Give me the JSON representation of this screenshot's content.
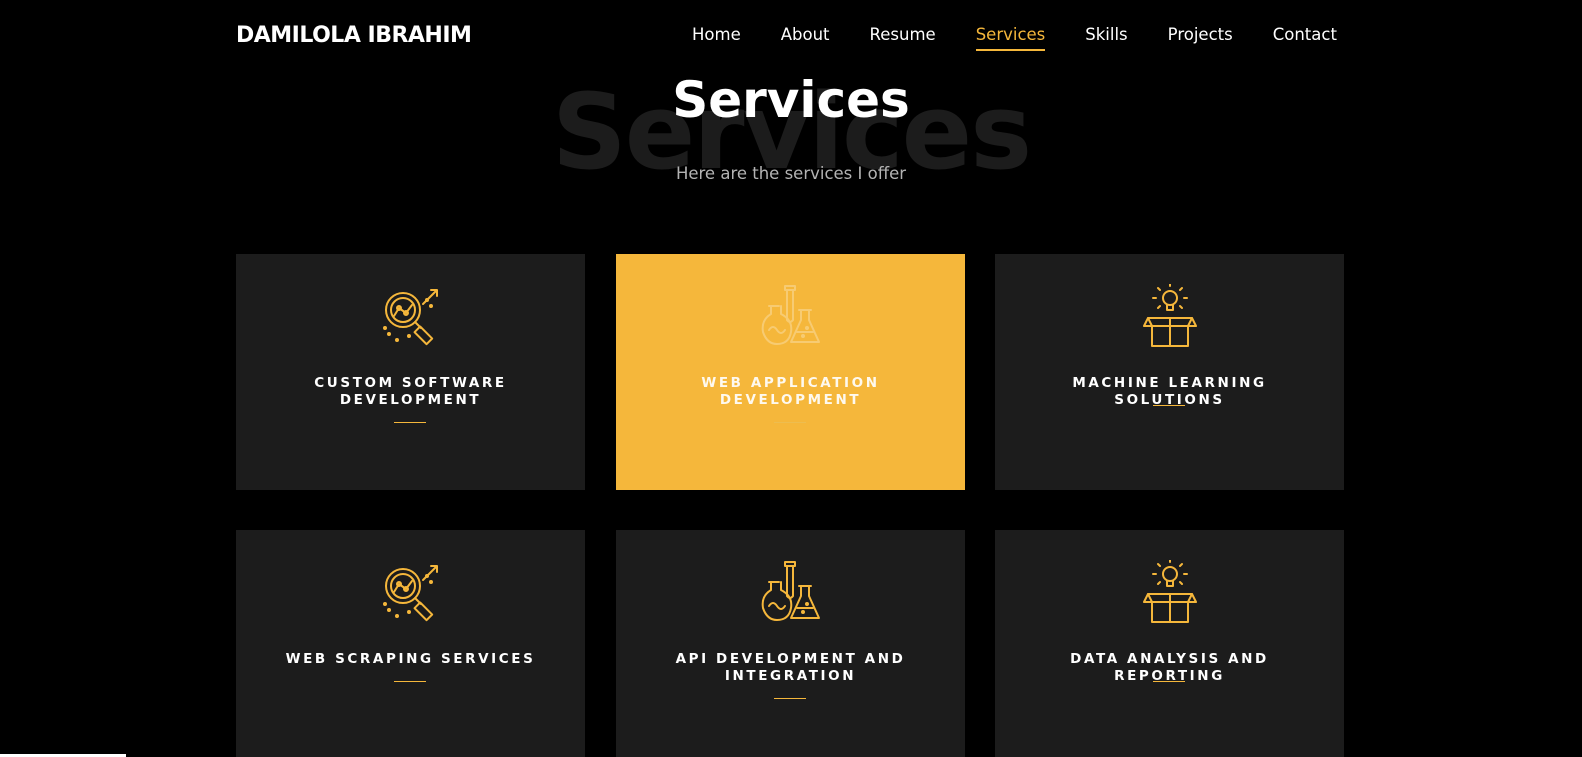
{
  "header": {
    "logo": "DAMILOLA IBRAHIM",
    "nav": [
      "Home",
      "About",
      "Resume",
      "Services",
      "Skills",
      "Projects",
      "Contact"
    ],
    "active_nav": "Services"
  },
  "section": {
    "bg_title": "Services",
    "title": "Services",
    "subtitle": "Here are the services I offer"
  },
  "services": [
    {
      "label": "Custom Software Development",
      "icon": "magnifier-chart-icon"
    },
    {
      "label": "Web Application Development",
      "icon": "lab-flasks-icon"
    },
    {
      "label": "Machine Learning Solutions",
      "icon": "idea-box-icon"
    },
    {
      "label": "Web Scraping Services",
      "icon": "magnifier-chart-icon"
    },
    {
      "label": "API Development and Integration",
      "icon": "lab-flasks-icon"
    },
    {
      "label": "Data Analysis and Reporting",
      "icon": "idea-box-icon"
    }
  ],
  "colors": {
    "accent": "#f5b73b",
    "card": "#1c1c1c",
    "background": "#000000"
  }
}
